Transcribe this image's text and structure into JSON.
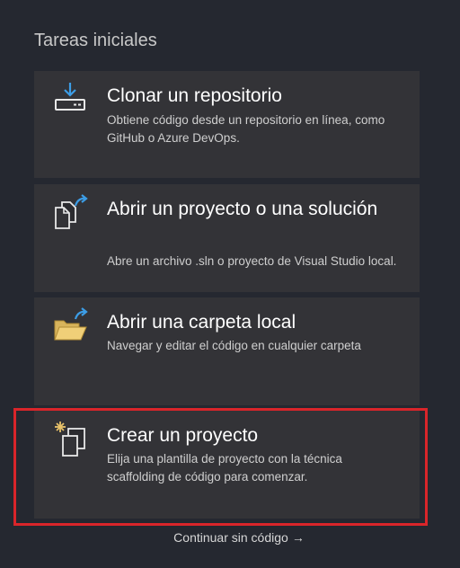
{
  "section": {
    "title": "Tareas iniciales"
  },
  "cards": [
    {
      "title": "Clonar un repositorio",
      "desc": "Obtiene código desde un repositorio en línea, como GitHub o Azure DevOps.",
      "icon": "download-drive-icon"
    },
    {
      "title": "Abrir un proyecto o una solución",
      "desc": "Abre un archivo .sln o proyecto de Visual Studio local.",
      "icon": "open-file-icon"
    },
    {
      "title": "Abrir una carpeta local",
      "desc": "Navegar y editar el código en cualquier carpeta",
      "icon": "open-folder-icon"
    },
    {
      "title": "Crear un proyecto",
      "desc": "Elija una plantilla de proyecto con la técnica scaffolding de código para comenzar.",
      "icon": "new-project-icon"
    }
  ],
  "continue": {
    "label": "Continuar sin código",
    "arrow": "→"
  },
  "colors": {
    "background": "#252830",
    "card": "#333337",
    "accent_blue": "#3c9de6",
    "folder": "#e8c26a",
    "highlight": "#d9252a"
  }
}
